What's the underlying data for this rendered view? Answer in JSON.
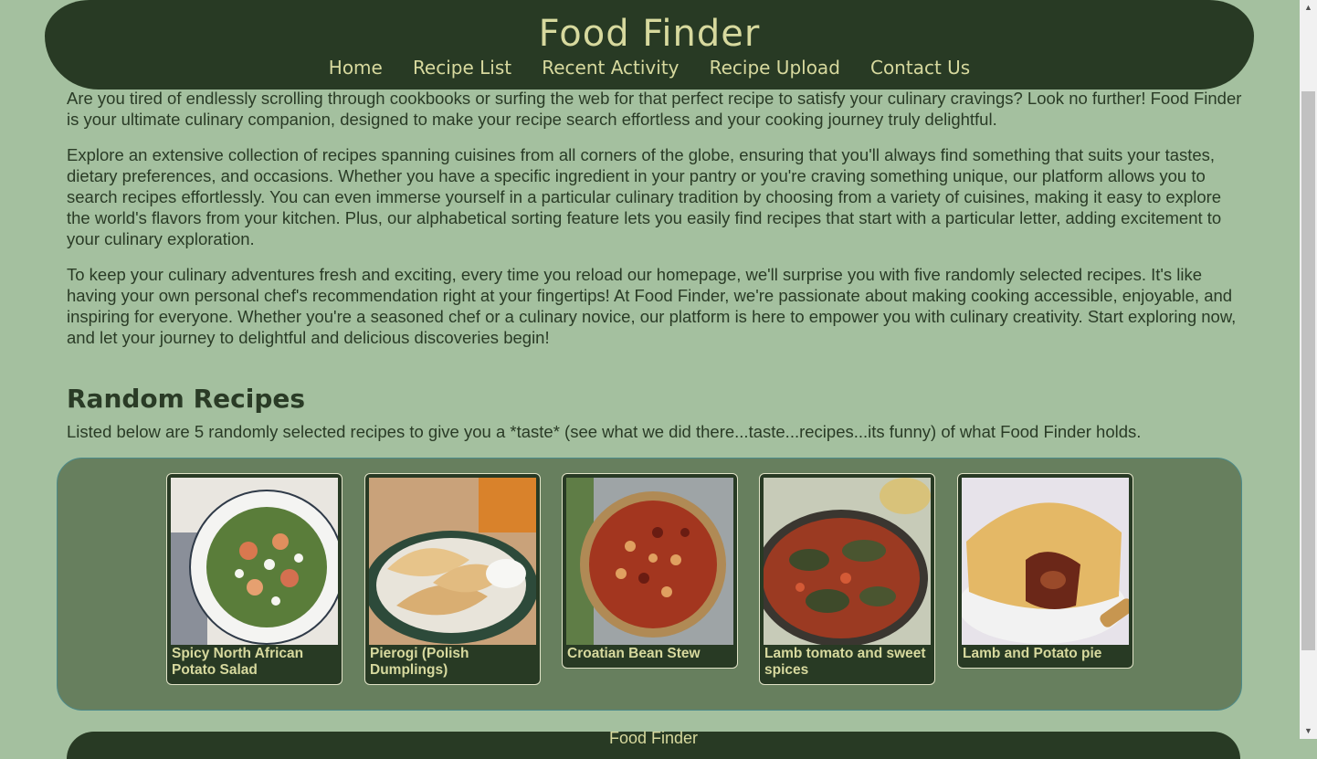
{
  "header": {
    "title": "Food Finder",
    "nav": [
      "Home",
      "Recipe List",
      "Recent Activity",
      "Recipe Upload",
      "Contact Us"
    ]
  },
  "intro": {
    "paragraphs": [
      "Are you tired of endlessly scrolling through cookbooks or surfing the web for that perfect recipe to satisfy your culinary cravings? Look no further! Food Finder is your ultimate culinary companion, designed to make your recipe search effortless and your cooking journey truly delightful.",
      "Explore an extensive collection of recipes spanning cuisines from all corners of the globe, ensuring that you'll always find something that suits your tastes, dietary preferences, and occasions. Whether you have a specific ingredient in your pantry or you're craving something unique, our platform allows you to search recipes effortlessly. You can even immerse yourself in a particular culinary tradition by choosing from a variety of cuisines, making it easy to explore the world's flavors from your kitchen. Plus, our alphabetical sorting feature lets you easily find recipes that start with a particular letter, adding excitement to your culinary exploration.",
      "To keep your culinary adventures fresh and exciting, every time you reload our homepage, we'll surprise you with five randomly selected recipes. It's like having your own personal chef's recommendation right at your fingertips! At Food Finder, we're passionate about making cooking accessible, enjoyable, and inspiring for everyone. Whether you're a seasoned chef or a culinary novice, our platform is here to empower you with culinary creativity. Start exploring now, and let your journey to delightful and delicious discoveries begin!"
    ]
  },
  "random": {
    "title": "Random Recipes",
    "subtitle": "Listed below are 5 randomly selected recipes to give you a *taste* (see what we did there...taste...recipes...its funny) of what Food Finder holds.",
    "recipes": [
      {
        "name": "Spicy North African Potato Salad"
      },
      {
        "name": "Pierogi (Polish Dumplings)"
      },
      {
        "name": "Croatian Bean Stew"
      },
      {
        "name": "Lamb tomato and sweet spices"
      },
      {
        "name": "Lamb and Potato pie"
      }
    ]
  },
  "footer": {
    "title": "Food Finder"
  },
  "colors": {
    "background": "#a4c09f",
    "header": "#283a24",
    "accent": "#d7d99e",
    "gallery": "#677f5e"
  }
}
